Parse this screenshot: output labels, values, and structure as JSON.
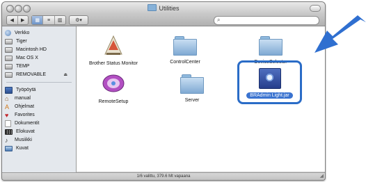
{
  "window": {
    "title": "Utilities",
    "status": "1/6 valittu, 379.6 Mt vapaana"
  },
  "toolbar": {
    "back_glyph": "◀",
    "forward_glyph": "▶",
    "view_icon_glyph": "▦",
    "view_list_glyph": "≡",
    "view_column_glyph": "▥",
    "action_glyph": "⚙▾",
    "search_value": "",
    "search_placeholder": ""
  },
  "sidebar": {
    "items": [
      {
        "label": "Verkko",
        "icon": "network-icon"
      },
      {
        "label": "Tiger",
        "icon": "disk-icon"
      },
      {
        "label": "Macintosh HD",
        "icon": "disk-icon"
      },
      {
        "label": "Mac OS X",
        "icon": "disk-icon"
      },
      {
        "label": "TEMP",
        "icon": "disk-icon"
      },
      {
        "label": "REMOVABLE",
        "icon": "disk-icon"
      },
      {
        "label": "Työpöytä",
        "icon": "desktop-icon"
      },
      {
        "label": "manual",
        "icon": "home-icon"
      },
      {
        "label": "Ohjelmat",
        "icon": "applications-icon"
      },
      {
        "label": "Favorites",
        "icon": "favorites-icon"
      },
      {
        "label": "Dokumentit",
        "icon": "documents-icon"
      },
      {
        "label": "Elokuvat",
        "icon": "movies-icon"
      },
      {
        "label": "Musiikki",
        "icon": "music-icon"
      },
      {
        "label": "Kuvat",
        "icon": "pictures-icon"
      }
    ],
    "eject_glyph": "⏏"
  },
  "files": [
    {
      "label": "Brother Status Monitor",
      "icon": "status-monitor-app-icon"
    },
    {
      "label": "ControlCenter",
      "icon": "folder-icon"
    },
    {
      "label": "DeviceSelector",
      "icon": "folder-icon"
    },
    {
      "label": "RemoteSetup",
      "icon": "remote-setup-app-icon"
    },
    {
      "label": "Server",
      "icon": "folder-icon"
    },
    {
      "label": "BRAdmin Light.jar",
      "icon": "jar-file-icon",
      "selected": true
    }
  ],
  "annotation": {
    "arrow_color": "#2f6fd0",
    "highlight_color": "#2a6cc7"
  }
}
